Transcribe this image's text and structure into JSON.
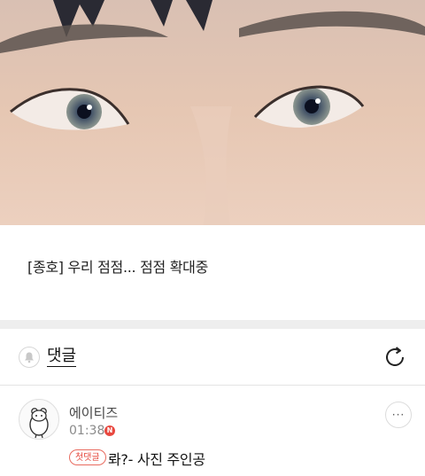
{
  "post": {
    "caption": "[종호] 우리 점점... 점점 확대중"
  },
  "comments_section": {
    "label": "댓글",
    "icons": {
      "bell": "bell-icon",
      "refresh": "refresh-icon"
    }
  },
  "comment": {
    "author": "에이티즈",
    "time": "01:38",
    "new_badge": "N",
    "first_comment_tag": "첫댓글",
    "text": "롸?- 사진 주인공",
    "more": "···"
  },
  "colors": {
    "accent_red": "#e5483d",
    "divider": "#eeeeee",
    "skin": "#e7c8b6"
  }
}
